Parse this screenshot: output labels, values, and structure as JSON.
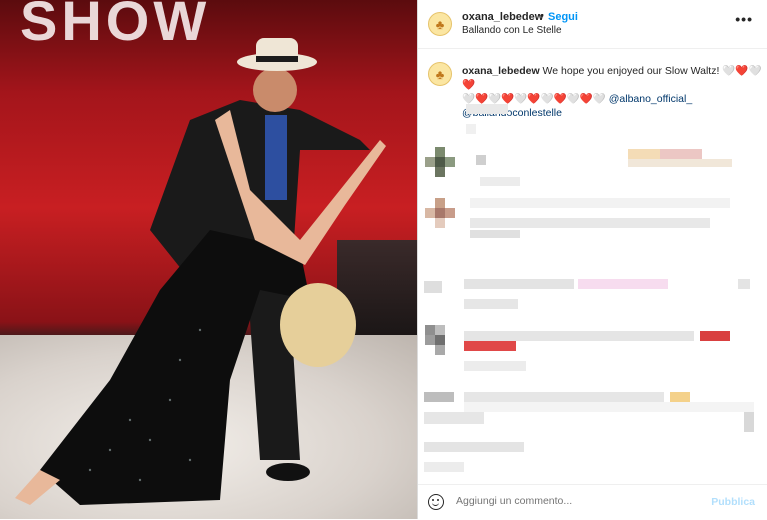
{
  "post": {
    "username": "oxana_lebedew",
    "separator": "•",
    "follow_label": "Segui",
    "location": "Ballando con Le Stelle",
    "more_label": "•••"
  },
  "caption": {
    "username": "oxana_lebedew",
    "text": " We hope you enjoyed our Slow Waltz! ",
    "hearts_line1": "🤍❤️🤍❤️",
    "hearts_line2": "🤍❤️🤍❤️🤍❤️🤍❤️🤍❤️🤍",
    "mention1": "@albano_official_",
    "mention2": "@ballandoconlestelle"
  },
  "photo": {
    "banner_text": "SHOW"
  },
  "comment_box": {
    "placeholder": "Aggiungi un commento...",
    "publish_label": "Pubblica"
  },
  "colors": {
    "accent": "#0095f6",
    "heart": "#e0245e",
    "publish_disabled": "#b2dffc"
  }
}
